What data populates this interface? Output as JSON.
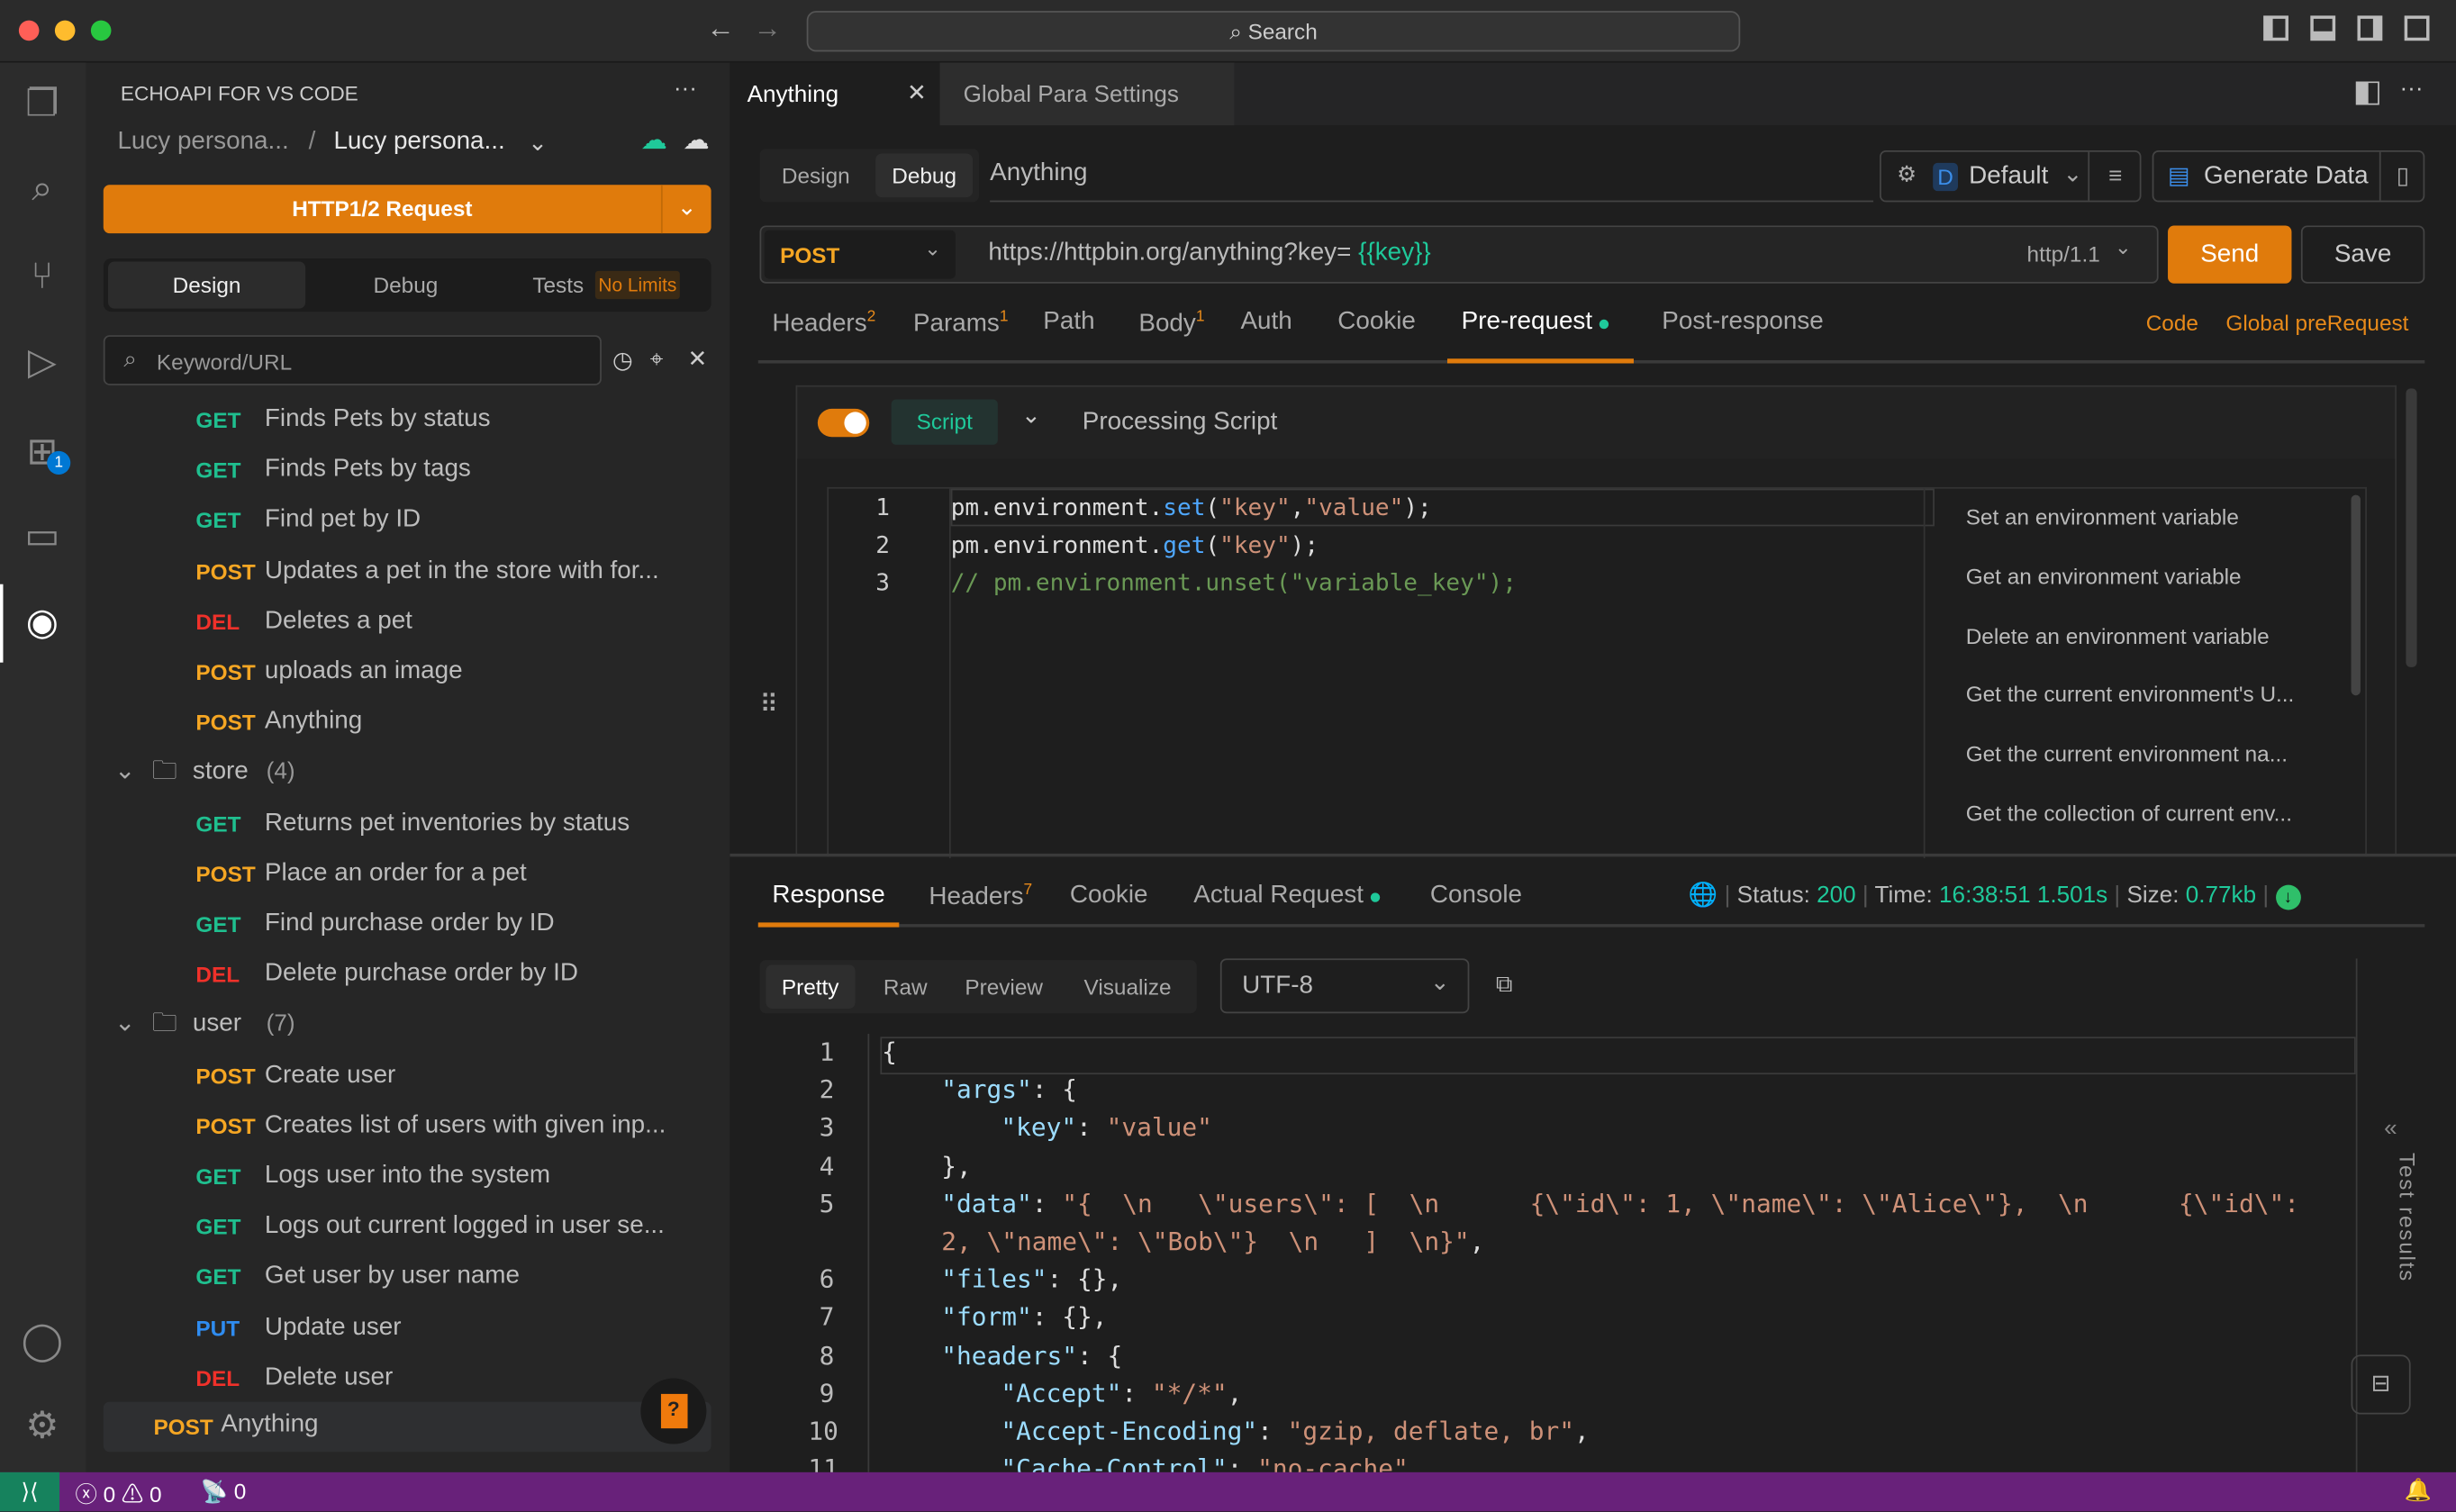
{
  "window": {
    "search_placeholder": "Search"
  },
  "sidebar": {
    "title": "ECHOAPI FOR VS CODE",
    "breadcrumb": [
      "Lucy persona...",
      "Lucy persona..."
    ],
    "new_request_label": "HTTP1/2 Request",
    "mode_tabs": [
      "Design",
      "Debug",
      "Tests"
    ],
    "tests_badge": "No Limits",
    "search_placeholder": "Keyword/URL",
    "items": [
      {
        "type": "api",
        "method": "GET",
        "name": "Finds Pets by status"
      },
      {
        "type": "api",
        "method": "GET",
        "name": "Finds Pets by tags"
      },
      {
        "type": "api",
        "method": "GET",
        "name": "Find pet by ID"
      },
      {
        "type": "api",
        "method": "POST",
        "name": "Updates a pet in the store with for..."
      },
      {
        "type": "api",
        "method": "DEL",
        "name": "Deletes a pet"
      },
      {
        "type": "api",
        "method": "POST",
        "name": "uploads an image"
      },
      {
        "type": "api",
        "method": "POST",
        "name": "Anything"
      },
      {
        "type": "folder",
        "name": "store",
        "count": "(4)"
      },
      {
        "type": "api",
        "method": "GET",
        "name": "Returns pet inventories by status"
      },
      {
        "type": "api",
        "method": "POST",
        "name": "Place an order for a pet"
      },
      {
        "type": "api",
        "method": "GET",
        "name": "Find purchase order by ID"
      },
      {
        "type": "api",
        "method": "DEL",
        "name": "Delete purchase order by ID"
      },
      {
        "type": "folder",
        "name": "user",
        "count": "(7)"
      },
      {
        "type": "api",
        "method": "POST",
        "name": "Create user"
      },
      {
        "type": "api",
        "method": "POST",
        "name": "Creates list of users with given inp..."
      },
      {
        "type": "api",
        "method": "GET",
        "name": "Logs user into the system"
      },
      {
        "type": "api",
        "method": "GET",
        "name": "Logs out current logged in user se..."
      },
      {
        "type": "api",
        "method": "GET",
        "name": "Get user by user name"
      },
      {
        "type": "api",
        "method": "PUT",
        "name": "Update user"
      },
      {
        "type": "api",
        "method": "DEL",
        "name": "Delete user"
      }
    ],
    "selected": {
      "method": "POST",
      "name": "Anything"
    }
  },
  "editor_tabs": [
    {
      "label": "Anything",
      "active": true
    },
    {
      "label": "Global Para Settings",
      "active": false
    }
  ],
  "request": {
    "mode_tabs": [
      "Design",
      "Debug"
    ],
    "name": "Anything",
    "environment": "Default",
    "environment_badge": "D",
    "generate_label": "Generate Data",
    "method": "POST",
    "url_prefix": "https://httpbin.org/anything?key=",
    "url_var": "{{key}}",
    "protocol": "http/1.1",
    "send_label": "Send",
    "save_label": "Save",
    "tabs": [
      {
        "label": "Headers",
        "count": "2"
      },
      {
        "label": "Params",
        "count": "1"
      },
      {
        "label": "Path"
      },
      {
        "label": "Body",
        "count": "1"
      },
      {
        "label": "Auth"
      },
      {
        "label": "Cookie"
      },
      {
        "label": "Pre-request",
        "active": true
      },
      {
        "label": "Post-response"
      }
    ],
    "code_link": "Code",
    "global_link": "Global preRequest",
    "script": {
      "enabled": true,
      "type_label": "Script",
      "title": "Processing Script",
      "lines": [
        [
          [
            "w",
            "pm.environment."
          ],
          [
            "f",
            "set"
          ],
          [
            "w",
            "("
          ],
          [
            "s",
            "\"key\""
          ],
          [
            "w",
            ","
          ],
          [
            "s",
            "\"value\""
          ],
          [
            "w",
            ");"
          ]
        ],
        [
          [
            "w",
            "pm.environment."
          ],
          [
            "f",
            "get"
          ],
          [
            "w",
            "("
          ],
          [
            "s",
            "\"key\""
          ],
          [
            "w",
            ");"
          ]
        ],
        [
          [
            "c",
            "// pm.environment.unset(\"variable_key\");"
          ]
        ]
      ],
      "snippets": [
        "Set an environment variable",
        "Get an environment variable",
        "Delete an environment variable",
        "Get the current environment's U...",
        "Get the current environment na...",
        "Get the collection of current env..."
      ]
    }
  },
  "response": {
    "tabs": [
      {
        "label": "Response",
        "active": true
      },
      {
        "label": "Headers",
        "count": "7"
      },
      {
        "label": "Cookie"
      },
      {
        "label": "Actual Request"
      },
      {
        "label": "Console"
      }
    ],
    "status_label": "Status:",
    "status": "200",
    "time_label": "Time:",
    "time": "16:38:51 1.501s",
    "size_label": "Size:",
    "size": "0.77kb",
    "view_tabs": [
      "Pretty",
      "Raw",
      "Preview",
      "Visualize"
    ],
    "encoding": "UTF-8",
    "side_label": "Test results",
    "lines": [
      {
        "n": "1",
        "ind": 0,
        "t": [
          [
            "w",
            "{"
          ]
        ]
      },
      {
        "n": "2",
        "ind": 1,
        "t": [
          [
            "k",
            "\"args\""
          ],
          [
            "w",
            ": {"
          ]
        ]
      },
      {
        "n": "3",
        "ind": 2,
        "t": [
          [
            "k",
            "\"key\""
          ],
          [
            "w",
            ": "
          ],
          [
            "s",
            "\"value\""
          ]
        ]
      },
      {
        "n": "4",
        "ind": 1,
        "t": [
          [
            "w",
            "},"
          ]
        ]
      },
      {
        "n": "5",
        "ind": 1,
        "t": [
          [
            "k",
            "\"data\""
          ],
          [
            "w",
            ": "
          ],
          [
            "s",
            "\"{  \\n   \\\"users\\\": [  \\n      {\\\"id\\\": 1, \\\"name\\\": \\\"Alice\\\"},  \\n      {\\\"id\\\":"
          ]
        ]
      },
      {
        "n": "",
        "ind": 1,
        "t": [
          [
            "s",
            "2, \\\"name\\\": \\\"Bob\\\"}  \\n   ]  \\n}\""
          ],
          [
            "w",
            ","
          ]
        ]
      },
      {
        "n": "6",
        "ind": 1,
        "t": [
          [
            "k",
            "\"files\""
          ],
          [
            "w",
            ": {},"
          ]
        ]
      },
      {
        "n": "7",
        "ind": 1,
        "t": [
          [
            "k",
            "\"form\""
          ],
          [
            "w",
            ": {},"
          ]
        ]
      },
      {
        "n": "8",
        "ind": 1,
        "t": [
          [
            "k",
            "\"headers\""
          ],
          [
            "w",
            ": {"
          ]
        ]
      },
      {
        "n": "9",
        "ind": 2,
        "t": [
          [
            "k",
            "\"Accept\""
          ],
          [
            "w",
            ": "
          ],
          [
            "s",
            "\"*/*\""
          ],
          [
            "w",
            ","
          ]
        ]
      },
      {
        "n": "10",
        "ind": 2,
        "t": [
          [
            "k",
            "\"Accept-Encoding\""
          ],
          [
            "w",
            ": "
          ],
          [
            "s",
            "\"gzip, deflate, br\""
          ],
          [
            "w",
            ","
          ]
        ]
      },
      {
        "n": "11",
        "ind": 2,
        "t": [
          [
            "k",
            "\"Cache-Control\""
          ],
          [
            "w",
            ": "
          ],
          [
            "s",
            "\"no-cache\""
          ]
        ]
      }
    ]
  },
  "statusbar": {
    "errors": "0",
    "warnings": "0",
    "ports": "0"
  },
  "colors": {
    "accent": "#e07b0c",
    "success": "#1fc99a",
    "statusbar": "#68217a"
  }
}
